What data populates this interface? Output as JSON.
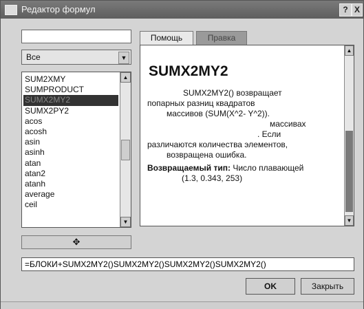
{
  "window": {
    "title": "Редактор формул",
    "help_label": "?",
    "close_label": "X"
  },
  "search": {
    "value": ""
  },
  "category": {
    "selected": "Все"
  },
  "functions": [
    "SUM2XMY",
    "SUMPRODUCT",
    "SUMX2MY2",
    "SUMX2PY2",
    "acos",
    "acosh",
    "asin",
    "asinh",
    "atan",
    "atan2",
    "atanh",
    "average",
    "ceil"
  ],
  "selected_function_index": 2,
  "insert_button_icon": "down-arrow-icon",
  "insert_button_glyph": "✥",
  "tabs": [
    "Помощь",
    "Правка"
  ],
  "active_tab": 0,
  "help": {
    "title": "SUMX2MY2",
    "lines": [
      "SUMX2MY2() возвращает",
      "попарных разниц квадратов",
      "массивов (SUM(X^2- Y^2)).",
      "массивах",
      ". Если",
      "различаются    количества элементов,",
      "возвращена ошибка."
    ],
    "return_label": "Возвращаемый тип:",
    "return_value": "Число    плавающей",
    "example": "(1.3, 0.343, 253)"
  },
  "formula": {
    "value": "=БЛОКИ+SUMX2MY2()SUMX2MY2()SUMX2MY2()SUMX2MY2()"
  },
  "buttons": {
    "ok": "OK",
    "cancel": "Закрыть"
  }
}
